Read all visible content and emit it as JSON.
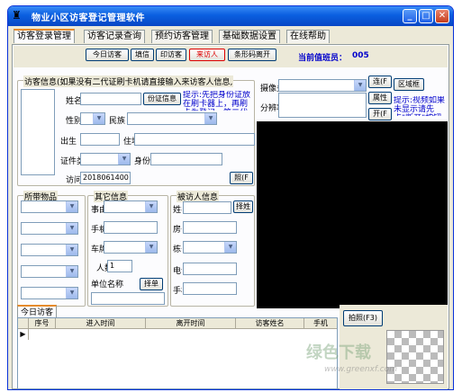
{
  "window": {
    "title": "物业小区访客登记管理软件",
    "minimize": "_",
    "maximize": "□",
    "close": "✕"
  },
  "tabs": [
    "访客登录管理",
    "访客记录查询",
    "预约访客管理",
    "基础数据设置",
    "在线帮助"
  ],
  "toolbar": {
    "today": "今日访客",
    "fill": "填信",
    "print": "印访客",
    "register": "来访人",
    "barcode": "条形码离开",
    "duty_label": "当前值班员：",
    "duty_value": "005"
  },
  "visitor": {
    "legend": "访客信息",
    "notice": "(如果没有二代证刷卡机请直接输入来访客人信息,",
    "name_label": "姓名",
    "id_read_btn": "份证信息",
    "tip": "提示:先把身份证放在刷卡器上，再刷卡为登记。第二代",
    "gender_label": "性别",
    "ethnicity_label": "民族",
    "birth_label": "出生",
    "address_label": "住址",
    "id_type_label": "证件类",
    "id_no_label": "身份证",
    "visit_no_label": "访问",
    "visit_no_value": "2018061400",
    "photo_btn": "照(F"
  },
  "camera": {
    "label": "摄像头",
    "resolution_label": "分辨率",
    "connect_btn": "连(F",
    "region_btn": "区域框",
    "props_btn": "属性",
    "open_btn": "开(F",
    "tip": "提示:视频如果未显示请先点\"断开\"按钮再"
  },
  "belongings": {
    "legend": "所带物品"
  },
  "other": {
    "legend": "其它信息",
    "reason_label": "事由",
    "phone_label": "手机",
    "plate_label": "车牌",
    "count_label": "人数",
    "count_value": "1",
    "unit_label": "单位名称",
    "select_btn": "择单"
  },
  "host": {
    "legend": "被访人信息",
    "name_label": "姓名",
    "select_btn": "择姓",
    "room_label": "房号",
    "building_label": "栋号",
    "tel_label": "电话",
    "mobile_label": "手机"
  },
  "today_tab": "今日访客",
  "table": {
    "headers": [
      "序号",
      "进入时间",
      "离开时间",
      "访客姓名",
      "手机"
    ]
  },
  "capture_btn": "拍照(F3)",
  "watermark": {
    "logo": "绿色下载",
    "url": "www.greenxf.com"
  }
}
